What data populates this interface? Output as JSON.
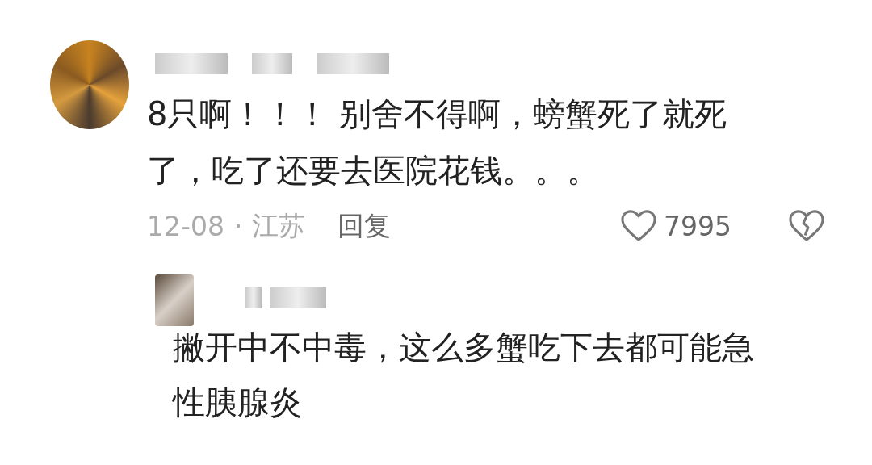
{
  "comment": {
    "text": "8只啊！！！ 别舍不得啊，螃蟹死了就死了，吃了还要去医院花钱。。。",
    "date": "12-08",
    "separator": "·",
    "location": "江苏",
    "reply_label": "回复",
    "likes": "7995",
    "liked": false
  },
  "reply": {
    "text": "撇开中不中毒，这么多蟹吃下去都可能急性胰腺炎"
  }
}
